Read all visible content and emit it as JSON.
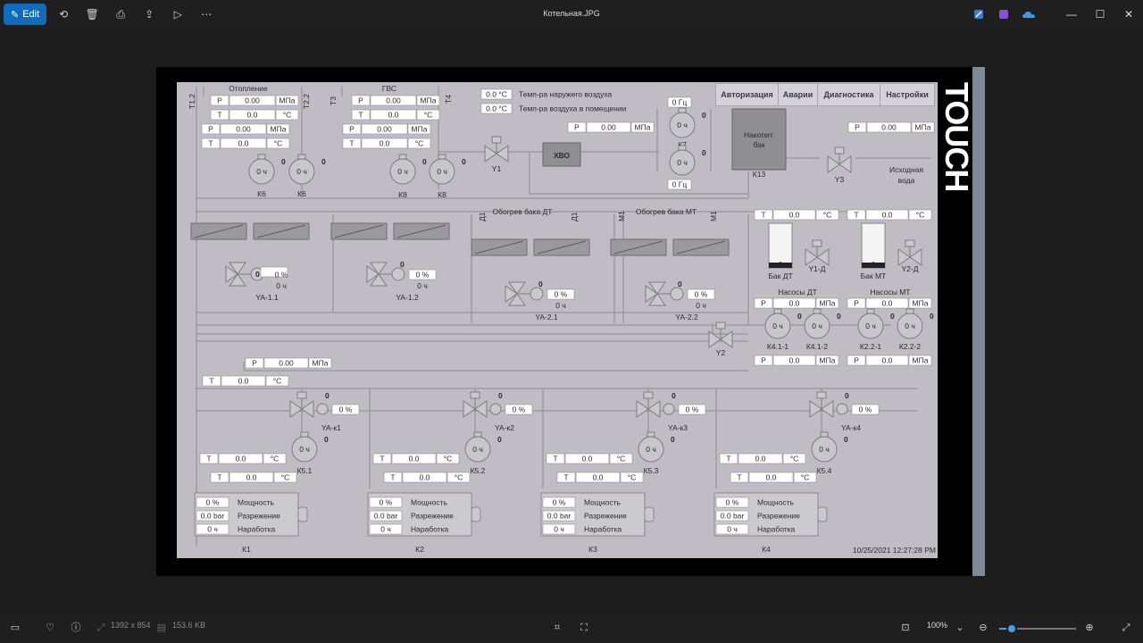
{
  "window": {
    "title": "Котельная.JPG"
  },
  "toolbar": {
    "edit_label": "Edit",
    "icons": [
      "rotate-icon",
      "delete-icon",
      "print-icon",
      "share-icon",
      "slideshow-icon",
      "more-icon"
    ]
  },
  "hmi": {
    "brand_text": "TOUCH",
    "menu": [
      "Авторизация",
      "Аварии",
      "Диагностика",
      "Настройки"
    ],
    "outdoor_temp": {
      "value": "0.0 °C",
      "label": "Темп-ра наружего воздуха"
    },
    "indoor_temp": {
      "value": "0.0 °C",
      "label": "Темп-ра воздуха в помещении"
    },
    "heating": {
      "title": "Отопление",
      "pipe_labels": [
        "T1.2",
        "T2.2"
      ],
      "rows": [
        {
          "k": "P",
          "v": "0.00",
          "u": "МПа"
        },
        {
          "k": "T",
          "v": "0.0",
          "u": "°C"
        },
        {
          "k": "P",
          "v": "0.00",
          "u": "МПа"
        },
        {
          "k": "T",
          "v": "0.0",
          "u": "°C"
        }
      ],
      "pumps": [
        {
          "name": "К6",
          "val": "0 ч",
          "status": "0"
        },
        {
          "name": "К6",
          "val": "0 ч",
          "status": "0"
        }
      ],
      "valve": {
        "name": "YA-1.1",
        "pct": "0 %",
        "hours": "0 ч",
        "status": "0"
      }
    },
    "hot_water": {
      "title": "ГВС",
      "pipe_labels": [
        "T3",
        "T4"
      ],
      "rows": [
        {
          "k": "P",
          "v": "0.00",
          "u": "МПа"
        },
        {
          "k": "T",
          "v": "0.0",
          "u": "°C"
        },
        {
          "k": "P",
          "v": "0.00",
          "u": "МПа"
        },
        {
          "k": "T",
          "v": "0.0",
          "u": "°C"
        }
      ],
      "pumps": [
        {
          "name": "К8",
          "val": "0 ч",
          "status": "0"
        },
        {
          "name": "К8",
          "val": "0 ч",
          "status": "0"
        }
      ],
      "valve": {
        "name": "YA-1.2",
        "pct": "0 %",
        "hours": "0 ч",
        "status": "0"
      }
    },
    "water_treatment": {
      "hvo_label": "ХВО",
      "pressure": {
        "k": "P",
        "v": "0.00",
        "u": "МПа"
      },
      "valve_y1": "Y1",
      "pump_k7": {
        "name": "К7",
        "top_freq": "0 Гц",
        "bottom_freq": "0 Гц",
        "val": "0 ч",
        "status": "0"
      },
      "tank": {
        "label": "Накопит. бак",
        "name": "К13"
      },
      "valve_y3": "Y3",
      "source_pressure": {
        "k": "P",
        "v": "0.00",
        "u": "МПа"
      },
      "source_label": "Исходная вода"
    },
    "tank_heating_dt": {
      "title": "Обогрев бака ДТ",
      "pipe_labels": [
        "Д1",
        "Д1"
      ],
      "valve": {
        "name": "YA-2.1",
        "pct": "0 %",
        "hours": "0 ч",
        "status": "0"
      }
    },
    "tank_heating_mt": {
      "title": "Обогрев бака МТ",
      "pipe_labels": [
        "М1",
        "М1"
      ],
      "valve": {
        "name": "YA-2.2",
        "pct": "0 %",
        "hours": "0 ч",
        "status": "0"
      }
    },
    "valve_y2": "Y2",
    "fuel": {
      "dt": {
        "temp": {
          "k": "T",
          "v": "0.0",
          "u": "°C"
        },
        "tank": "Бак ДТ",
        "tank_level": "0",
        "valve": "Y1-Д",
        "pumps_title": "Насосы ДТ",
        "p_top": {
          "k": "P",
          "v": "0.0",
          "u": "МПа"
        },
        "pumps": [
          {
            "name": "К4.1-1",
            "val": "0 ч",
            "status": "0"
          },
          {
            "name": "К4.1-2",
            "val": "0 ч",
            "status": "0"
          }
        ],
        "p_bottom": {
          "k": "P",
          "v": "0.0",
          "u": "МПа"
        }
      },
      "mt": {
        "temp": {
          "k": "T",
          "v": "0.0",
          "u": "°C"
        },
        "tank": "Бак МТ",
        "tank_level": "0",
        "valve": "Y2-Д",
        "pumps_title": "Насосы МТ",
        "p_top": {
          "k": "P",
          "v": "0.0",
          "u": "МПа"
        },
        "pumps": [
          {
            "name": "К2.2-1",
            "val": "0 ч",
            "status": "0"
          },
          {
            "name": "К2.2-2",
            "val": "0 ч",
            "status": "0"
          }
        ],
        "p_bottom": {
          "k": "P",
          "v": "0.0",
          "u": "МПа"
        }
      }
    },
    "return_line": {
      "pressure": {
        "k": "P",
        "v": "0.00",
        "u": "МПа"
      },
      "temp": {
        "k": "T",
        "v": "0.0",
        "u": "°C"
      }
    },
    "boilers": [
      {
        "name": "К1",
        "valve": "YA-к1",
        "valve_pct": "0 %",
        "valve_status": "0",
        "pump": "К5.1",
        "pump_val": "0 ч",
        "pump_status": "0",
        "t1": "0.0",
        "t2": "0.0",
        "power": "0 %",
        "draft": "0.0 bar",
        "runtime": "0 ч"
      },
      {
        "name": "К2",
        "valve": "YA-к2",
        "valve_pct": "0 %",
        "valve_status": "0",
        "pump": "К5.2",
        "pump_val": "0 ч",
        "pump_status": "0",
        "t1": "0.0",
        "t2": "0.0",
        "power": "0 %",
        "draft": "0.0 bar",
        "runtime": "0 ч"
      },
      {
        "name": "К3",
        "valve": "YA-к3",
        "valve_pct": "0 %",
        "valve_status": "0",
        "pump": "К5.3",
        "pump_val": "0 ч",
        "pump_status": "0",
        "t1": "0.0",
        "t2": "0.0",
        "power": "0 %",
        "draft": "0.0 bar",
        "runtime": "0 ч"
      },
      {
        "name": "К4",
        "valve": "YA-к4",
        "valve_pct": "0 %",
        "valve_status": "0",
        "pump": "К5.4",
        "pump_val": "0 ч",
        "pump_status": "0",
        "t1": "0.0",
        "t2": "0.0",
        "power": "0 %",
        "draft": "0.0 bar",
        "runtime": "0 ч"
      }
    ],
    "boiler_labels": {
      "temp_key": "T",
      "temp_unit": "°C",
      "power": "Мощность",
      "draft": "Разрежение",
      "runtime": "Наработка"
    },
    "timestamp": "10/25/2021 12:27:28 PM"
  },
  "statusbar": {
    "dimensions": "1392 x 854",
    "filesize": "153.6 KB",
    "zoom": "100%",
    "zoom_fraction": 0.16
  },
  "colors": {
    "accent": "#0f6cbd",
    "status_magenta": "#c000c0",
    "hmi_bg": "#bfbdc3"
  }
}
